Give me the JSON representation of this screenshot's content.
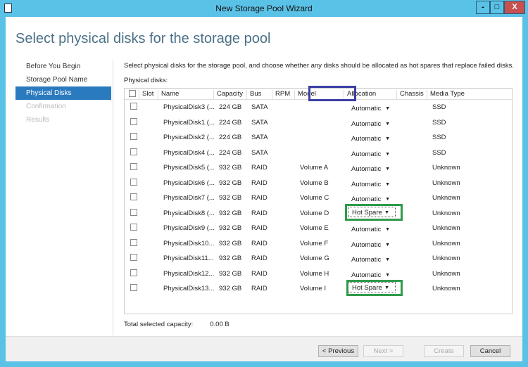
{
  "window": {
    "title": "New Storage Pool Wizard",
    "minimize": "-",
    "maximize": "□",
    "close": "X"
  },
  "heading": "Select physical disks for the storage pool",
  "sidebar": {
    "items": [
      {
        "label": "Before You Begin",
        "state": "normal"
      },
      {
        "label": "Storage Pool Name",
        "state": "normal"
      },
      {
        "label": "Physical Disks",
        "state": "selected"
      },
      {
        "label": "Confirmation",
        "state": "disabled"
      },
      {
        "label": "Results",
        "state": "disabled"
      }
    ]
  },
  "description": "Select physical disks for the storage pool, and choose whether any disks should be allocated as hot spares that replace failed disks.",
  "physical_disks_label": "Physical disks:",
  "columns": [
    "Slot",
    "Name",
    "Capacity",
    "Bus",
    "RPM",
    "Model",
    "Allocation",
    "Chassis",
    "Media Type"
  ],
  "rows": [
    {
      "name": "PhysicalDisk3 (...",
      "capacity": "224 GB",
      "bus": "SATA",
      "model": "",
      "allocation": "Automatic",
      "media": "SSD"
    },
    {
      "name": "PhysicalDisk1 (...",
      "capacity": "224 GB",
      "bus": "SATA",
      "model": "",
      "allocation": "Automatic",
      "media": "SSD"
    },
    {
      "name": "PhysicalDisk2 (...",
      "capacity": "224 GB",
      "bus": "SATA",
      "model": "",
      "allocation": "Automatic",
      "media": "SSD"
    },
    {
      "name": "PhysicalDisk4 (...",
      "capacity": "224 GB",
      "bus": "SATA",
      "model": "",
      "allocation": "Automatic",
      "media": "SSD"
    },
    {
      "name": "PhysicalDisk5 (...",
      "capacity": "932 GB",
      "bus": "RAID",
      "model": "Volume A",
      "allocation": "Automatic",
      "media": "Unknown"
    },
    {
      "name": "PhysicalDisk6 (...",
      "capacity": "932 GB",
      "bus": "RAID",
      "model": "Volume B",
      "allocation": "Automatic",
      "media": "Unknown"
    },
    {
      "name": "PhysicalDisk7 (...",
      "capacity": "932 GB",
      "bus": "RAID",
      "model": "Volume C",
      "allocation": "Automatic",
      "media": "Unknown"
    },
    {
      "name": "PhysicalDisk8 (...",
      "capacity": "932 GB",
      "bus": "RAID",
      "model": "Volume D",
      "allocation": "Hot Spare",
      "media": "Unknown"
    },
    {
      "name": "PhysicalDisk9 (...",
      "capacity": "932 GB",
      "bus": "RAID",
      "model": "Volume E",
      "allocation": "Automatic",
      "media": "Unknown"
    },
    {
      "name": "PhysicalDisk10...",
      "capacity": "932 GB",
      "bus": "RAID",
      "model": "Volume F",
      "allocation": "Automatic",
      "media": "Unknown"
    },
    {
      "name": "PhysicalDisk11...",
      "capacity": "932 GB",
      "bus": "RAID",
      "model": "Volume G",
      "allocation": "Automatic",
      "media": "Unknown"
    },
    {
      "name": "PhysicalDisk12...",
      "capacity": "932 GB",
      "bus": "RAID",
      "model": "Volume H",
      "allocation": "Automatic",
      "media": "Unknown"
    },
    {
      "name": "PhysicalDisk13...",
      "capacity": "932 GB",
      "bus": "RAID",
      "model": "Volume I",
      "allocation": "Hot Spare",
      "media": "Unknown"
    }
  ],
  "total": {
    "label": "Total selected capacity:",
    "value": "0.00 B"
  },
  "buttons": {
    "previous": "< Previous",
    "next": "Next >",
    "create": "Create",
    "cancel": "Cancel"
  },
  "colors": {
    "frame": "#5bc2e7",
    "selected": "#2a7ac0",
    "highlight_green": "#2f9a4b",
    "highlight_blue": "#3b3fa5"
  }
}
